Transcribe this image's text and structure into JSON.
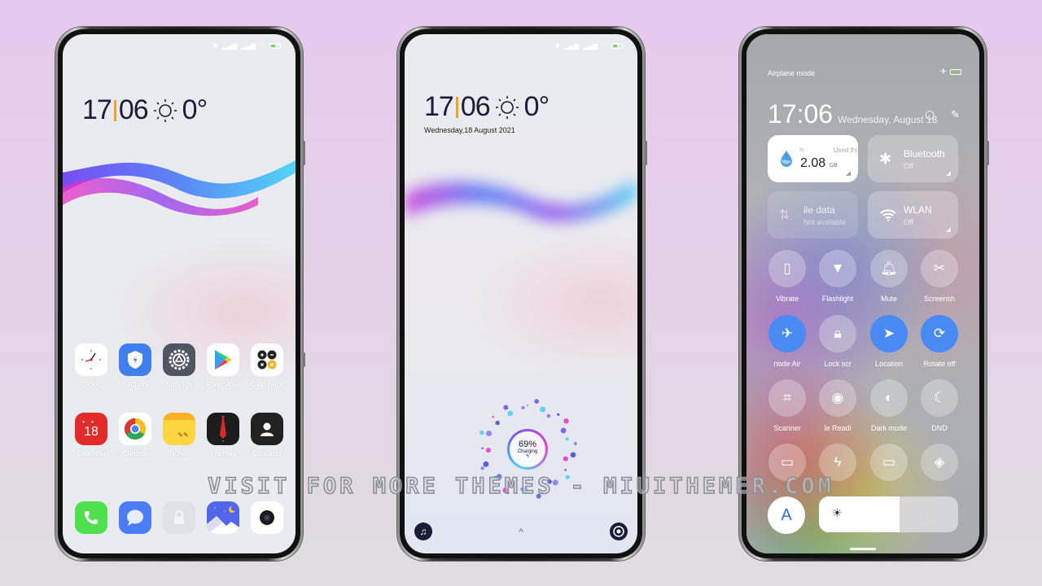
{
  "watermark": "VISIT FOR MORE THEMES - MIUITHEMER.COM",
  "colors": {
    "accent_orange": "#f1a21e",
    "toggle_on": "#4a8af4",
    "clock_text": "#1e1b3a"
  },
  "home_screen": {
    "status_icons": [
      "bluetooth-icon",
      "signal-icon",
      "signal-icon",
      "wifi-icon",
      "battery-icon"
    ],
    "clock": {
      "hours": "17",
      "minutes": "06",
      "weather_icon": "sun-icon",
      "temperature": "0°"
    },
    "apps_row1": [
      {
        "label": "Clock",
        "icon": "clock-icon"
      },
      {
        "label": "Security",
        "icon": "shield-icon"
      },
      {
        "label": "Settings",
        "icon": "gear-icon"
      },
      {
        "label": "Play Store",
        "icon": "play-store-icon"
      },
      {
        "label": "Calculator",
        "icon": "calculator-icon"
      }
    ],
    "apps_row2": [
      {
        "label": "Calendar",
        "icon": "calendar-icon",
        "badge": "18"
      },
      {
        "label": "Chrome",
        "icon": "chrome-icon"
      },
      {
        "label": "Notes",
        "icon": "notes-icon"
      },
      {
        "label": "Themes",
        "icon": "tie-icon"
      },
      {
        "label": "Contacts",
        "icon": "contact-icon"
      }
    ],
    "dock": [
      {
        "icon": "phone-icon"
      },
      {
        "icon": "message-icon"
      },
      {
        "icon": "lock-icon"
      },
      {
        "icon": "gallery-icon"
      },
      {
        "icon": "camera-icon"
      }
    ]
  },
  "lock_screen": {
    "clock": {
      "hours": "17",
      "minutes": "06",
      "weather_icon": "sun-icon",
      "temperature": "0°"
    },
    "date": "Wednesday,18 August 2021",
    "charging": {
      "percent": "69%",
      "label": "Charging",
      "level": 0.69
    },
    "up_arrow": "^"
  },
  "control_center": {
    "status_left": "Airplane mode",
    "time": "17:06",
    "date": "Wednesday, August 18",
    "data_tile": {
      "top_left": "h",
      "top_right": "Used thi",
      "value": "2.08",
      "unit": "GB"
    },
    "bluetooth_tile": {
      "title": "Bluetooth",
      "status": "Off"
    },
    "mobile_data_tile": {
      "title": "ile data",
      "status": "Not available"
    },
    "wlan_tile": {
      "title": "WLAN",
      "status": "Off"
    },
    "toggles": [
      {
        "label": "Vibrate",
        "icon": "vibrate-icon",
        "on": false
      },
      {
        "label": "Flashlight",
        "icon": "flashlight-icon",
        "on": false
      },
      {
        "label": "Mute",
        "icon": "bell-icon",
        "on": false
      },
      {
        "label": "Screensh",
        "icon": "screenshot-icon",
        "on": false
      },
      {
        "label": "node    Air",
        "icon": "airplane-icon",
        "on": true
      },
      {
        "label": "Lock scr",
        "icon": "lock-icon",
        "on": false
      },
      {
        "label": "Location",
        "icon": "location-icon",
        "on": true
      },
      {
        "label": "Rotate off",
        "icon": "rotate-lock-icon",
        "on": true
      },
      {
        "label": "Scanner",
        "icon": "scanner-icon",
        "on": false
      },
      {
        "label": "le    Readi",
        "icon": "eye-icon",
        "on": false
      },
      {
        "label": "Dark mode",
        "icon": "dark-mode-icon",
        "on": false
      },
      {
        "label": "DND",
        "icon": "moon-icon",
        "on": false
      },
      {
        "label": "",
        "icon": "battery-saver-icon",
        "on": false
      },
      {
        "label": "",
        "icon": "lightning-icon",
        "on": false
      },
      {
        "label": "",
        "icon": "cast-icon",
        "on": false
      },
      {
        "label": "",
        "icon": "mi-share-icon",
        "on": false
      }
    ],
    "auto_brightness_label": "A",
    "brightness": 0.58
  }
}
